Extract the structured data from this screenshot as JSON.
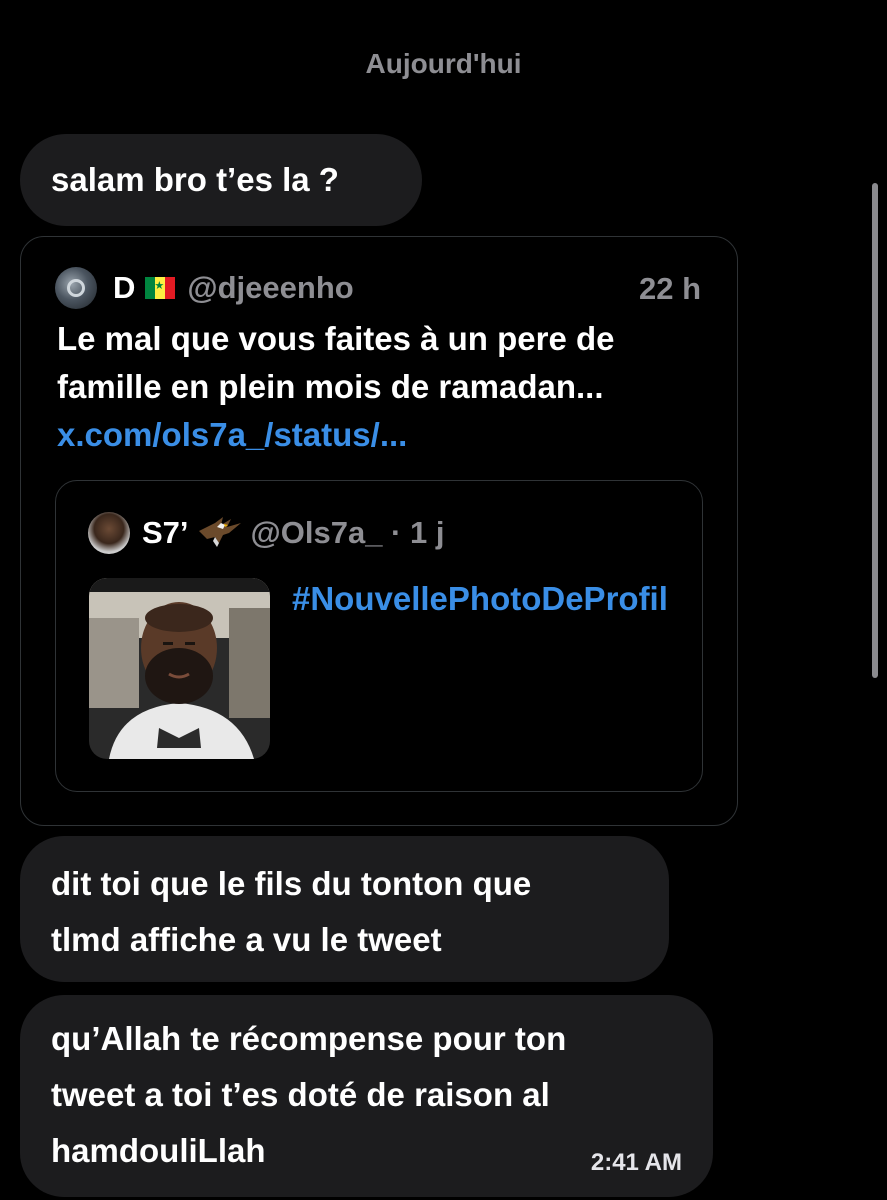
{
  "conversation": {
    "date_separator": "Aujourd'hui",
    "messages": [
      {
        "text": "salam bro t’es la ?"
      },
      {
        "text_line1": "dit toi que le fils du tonton que",
        "text_line2": "tlmd affiche a vu le tweet"
      },
      {
        "text_line1": "qu’Allah te récompense pour ton",
        "text_line2": "tweet a toi t’es doté de raison al",
        "text_line3": "hamdouliLlah",
        "time": "2:41 AM"
      }
    ]
  },
  "shared_tweet": {
    "author_name": "D",
    "author_flag": "senegal-flag-icon",
    "handle": "@djeeenho",
    "time": "22 h",
    "text_line1": "Le mal que vous faites à un pere de",
    "text_line2": "famille en plein mois de ramadan...",
    "link": "x.com/ols7a_/status/...",
    "quoted": {
      "author_name": "S7’",
      "author_emoji": "eagle-icon",
      "handle_time": "@Ols7a_ · 1 j",
      "hashtag": "#NouvellePhotoDeProfil"
    }
  },
  "colors": {
    "background": "#000000",
    "bubble": "#1c1c1e",
    "muted": "#8e8e93",
    "link": "#3a8ee6",
    "card_border": "#2f3336"
  }
}
